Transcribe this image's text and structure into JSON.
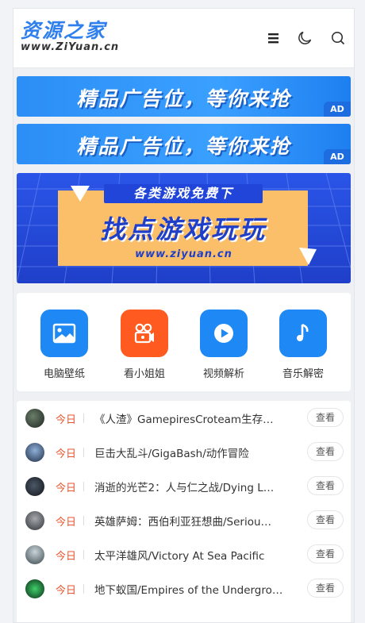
{
  "header": {
    "logo_main": "资源之家",
    "logo_sub": "www.ZiYuan.cn",
    "icons": [
      "menu-icon",
      "moon-icon",
      "search-icon"
    ]
  },
  "ads": [
    {
      "text": "精品广告位，等你来抢",
      "badge": "AD"
    },
    {
      "text": "精品广告位，等你来抢",
      "badge": "AD"
    }
  ],
  "banner": {
    "tagline": "各类游戏免费下",
    "headline": "找点游戏玩玩",
    "url": "www.ziyuan.cn"
  },
  "quick_links": [
    {
      "label": "电脑壁纸",
      "icon": "image-icon",
      "color": "#1e88f5"
    },
    {
      "label": "看小姐姐",
      "icon": "video-camera-icon",
      "color": "#ff5a1f"
    },
    {
      "label": "视频解析",
      "icon": "play-icon",
      "color": "#1e88f5"
    },
    {
      "label": "音乐解密",
      "icon": "music-note-icon",
      "color": "#1e88f5"
    }
  ],
  "list": {
    "items": [
      {
        "tag": "今日",
        "title": "《人渣》GamepiresCroteam生存…",
        "button": "查看"
      },
      {
        "tag": "今日",
        "title": "巨击大乱斗/GigaBash/动作冒险",
        "button": "查看"
      },
      {
        "tag": "今日",
        "title": "消逝的光芒2：人与仁之战/Dying L…",
        "button": "查看"
      },
      {
        "tag": "今日",
        "title": "英雄萨姆：西伯利亚狂想曲/Seriou…",
        "button": "查看"
      },
      {
        "tag": "今日",
        "title": "太平洋雄风/Victory At Sea Pacific",
        "button": "查看"
      },
      {
        "tag": "今日",
        "title": "地下蚁国/Empires of the Undergro…",
        "button": "查看"
      }
    ]
  }
}
